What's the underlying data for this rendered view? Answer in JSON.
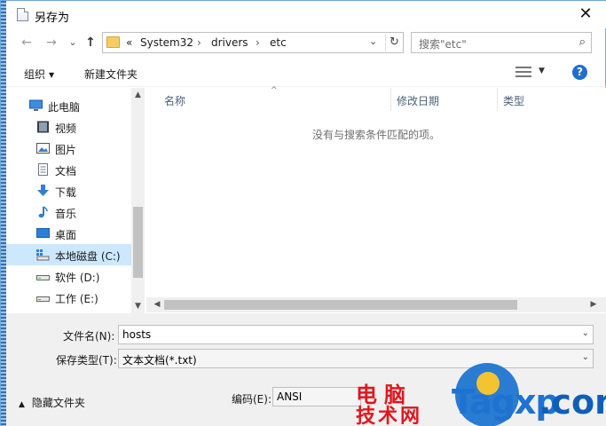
{
  "window": {
    "title": "另存为",
    "close_glyph": "✕"
  },
  "nav": {
    "back_glyph": "←",
    "forward_glyph": "→",
    "up_glyph": "↑",
    "address_overflow": "«",
    "breadcrumb": [
      "System32",
      "drivers",
      "etc"
    ],
    "breadcrumb_sep": "›",
    "address_dropdown_glyph": "⌄",
    "refresh_glyph": "↻",
    "search_placeholder": "搜索\"etc\"",
    "search_icon_glyph": "⌕"
  },
  "toolbar": {
    "organize_label": "组织",
    "new_folder_label": "新建文件夹",
    "caret_glyph": "▼",
    "help_glyph": "?"
  },
  "sidebar": {
    "items": [
      {
        "label": "此电脑",
        "icon": "computer-icon"
      },
      {
        "label": "视频",
        "icon": "video-icon"
      },
      {
        "label": "图片",
        "icon": "picture-icon"
      },
      {
        "label": "文档",
        "icon": "document-icon"
      },
      {
        "label": "下载",
        "icon": "download-icon"
      },
      {
        "label": "音乐",
        "icon": "music-icon"
      },
      {
        "label": "桌面",
        "icon": "desktop-icon"
      },
      {
        "label": "本地磁盘 (C:)",
        "icon": "drive-c-icon",
        "selected": true
      },
      {
        "label": "软件 (D:)",
        "icon": "drive-icon"
      },
      {
        "label": "工作 (E:)",
        "icon": "drive-icon"
      }
    ]
  },
  "content": {
    "columns": [
      "名称",
      "修改日期",
      "类型"
    ],
    "sort_glyph": "^",
    "empty_message": "没有与搜索条件匹配的项。"
  },
  "form": {
    "filename_label": "文件名(N):",
    "filename_value": "hosts",
    "type_label": "保存类型(T):",
    "type_value": "文本文档(*.txt)",
    "encoding_label": "编码(E):",
    "encoding_value": "ANSI",
    "hide_folders_label": "隐藏文件夹",
    "hide_caret_glyph": "▲",
    "dropdown_glyph": "⌄"
  },
  "watermark": {
    "cn_line1": "电脑",
    "cn_line2": "技术网",
    "en_text": "Tagxp",
    "en_suffix": ".com"
  },
  "colors": {
    "accent": "#1f6fd1",
    "selection": "#cce8ff",
    "watermark_red": "#e0161e",
    "watermark_blue": "#1e73d0"
  }
}
